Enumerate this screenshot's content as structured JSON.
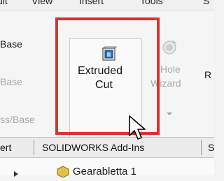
{
  "menubar": {
    "items": [
      "ult",
      "View",
      "Insert",
      "Tools",
      "S"
    ]
  },
  "ribbon": {
    "left_column": {
      "row1": "Base",
      "row2": "Base",
      "row3": "ss/Base"
    },
    "extruded_cut": {
      "line1": "Extruded",
      "line2": "Cut"
    },
    "hole_wizard": {
      "line1": "Hole",
      "line2": "Wizard"
    },
    "right_fragment": "R"
  },
  "tabs": {
    "items": [
      "ert",
      "SOLIDWORKS Add-Ins",
      "S"
    ]
  },
  "tree": {
    "item_label": "Gearabletta 1"
  },
  "colors": {
    "highlight": "#e02f2f",
    "icon_blue": "#2c6fb3",
    "disabled": "#a8a8a8"
  }
}
